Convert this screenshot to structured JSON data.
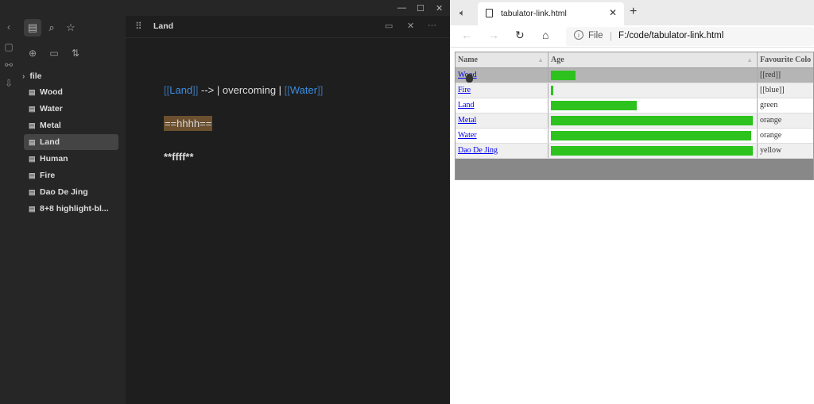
{
  "obsidian": {
    "window_controls": [
      "—",
      "☐",
      "✕"
    ],
    "sidebar": {
      "folder": "file",
      "files": [
        {
          "label": "Wood",
          "active": false
        },
        {
          "label": "Water",
          "active": false
        },
        {
          "label": "Metal",
          "active": false
        },
        {
          "label": "Land",
          "active": true
        },
        {
          "label": "Human",
          "active": false
        },
        {
          "label": "Fire",
          "active": false
        },
        {
          "label": "Dao De Jing",
          "active": false
        },
        {
          "label": "8+8 highlight-bl...",
          "active": false
        }
      ]
    },
    "editor": {
      "title": "Land",
      "line1": {
        "open1": "[[",
        "link1": "Land",
        "close1": "]]",
        "middle": " --> | overcoming | ",
        "open2": "[[",
        "link2": "Water",
        "close2": "]]"
      },
      "line2": "==hhhh==",
      "line3": "**ffff**"
    }
  },
  "browser": {
    "tab_title": "tabulator-link.html",
    "address": {
      "scheme": "File",
      "url": "F:/code/tabulator-link.html"
    },
    "table": {
      "columns": [
        "Name",
        "Age",
        "Favourite Colo"
      ],
      "rows": [
        {
          "name": "Wood",
          "age_fraction": 0.12,
          "colour": "[[red]]"
        },
        {
          "name": "Fire",
          "age_fraction": 0.01,
          "colour": "[[blue]]"
        },
        {
          "name": "Land",
          "age_fraction": 0.42,
          "colour": "green"
        },
        {
          "name": "Metal",
          "age_fraction": 0.99,
          "colour": "orange"
        },
        {
          "name": "Water",
          "age_fraction": 0.98,
          "colour": "orange"
        },
        {
          "name": "Dao De Jing",
          "age_fraction": 0.99,
          "colour": "yellow"
        }
      ]
    },
    "colors": {
      "bar": "#2dc21d",
      "link": "#0000ee",
      "obsidian_link": "#3b8ee0",
      "highlight": "#6b4f2e"
    }
  }
}
